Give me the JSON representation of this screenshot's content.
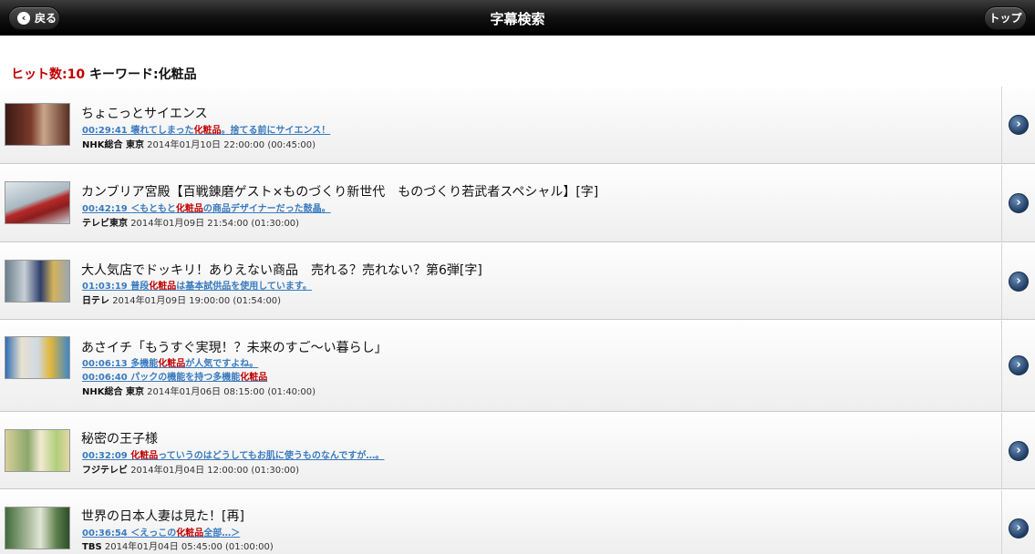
{
  "header": {
    "title": "字幕検索",
    "back_label": "戻る",
    "top_label": "トップ"
  },
  "search": {
    "hits_label": "ヒット数:10",
    "keyword_label": "キーワード:化粧品"
  },
  "colors": {
    "accent_red": "#c00000",
    "link_blue": "#3a7bbf"
  },
  "results": [
    {
      "title": "ちょこっとサイエンス",
      "subs": [
        {
          "time": "00:29:41",
          "before": "壊れてしまった",
          "kw": "化粧品",
          "after": "。捨てる前にサイエンス！"
        }
      ],
      "channel": "NHK総合 東京",
      "date": "2014年01月10日 22:00:00 (00:45:00)"
    },
    {
      "title": "カンブリア宮殿【百戦錬磨ゲスト×ものづくり新世代　ものづくり若武者スペシャル】[字]",
      "subs": [
        {
          "time": "00:42:19",
          "before": "＜もともと",
          "kw": "化粧品",
          "after": "の商品デザイナーだった鼓晶。"
        }
      ],
      "channel": "テレビ東京",
      "date": "2014年01月09日 21:54:00 (01:30:00)"
    },
    {
      "title": "大人気店でドッキリ！ありえない商品　売れる？売れない？第6弾[字]",
      "subs": [
        {
          "time": "01:03:19",
          "before": "普段",
          "kw": "化粧品",
          "after": "は基本試供品を使用しています。"
        }
      ],
      "channel": "日テレ",
      "date": "2014年01月09日 19:00:00 (01:54:00)"
    },
    {
      "title": "あさイチ「もうすぐ実現！？未来のすご～い暮らし」",
      "subs": [
        {
          "time": "00:06:13",
          "before": "多機能",
          "kw": "化粧品",
          "after": "が人気ですよね。"
        },
        {
          "time": "00:06:40",
          "before": "パックの機能を持つ多機能",
          "kw": "化粧品",
          "after": ""
        }
      ],
      "channel": "NHK総合 東京",
      "date": "2014年01月06日 08:15:00 (01:40:00)"
    },
    {
      "title": "秘密の王子様",
      "subs": [
        {
          "time": "00:32:09",
          "before": "",
          "kw": "化粧品",
          "after": "っていうのはどうしてもお肌に使うものなんですが…。"
        }
      ],
      "channel": "フジテレビ",
      "date": "2014年01月04日 12:00:00 (01:30:00)"
    },
    {
      "title": "世界の日本人妻は見た！[再]",
      "subs": [
        {
          "time": "00:36:54",
          "before": "＜えっこの",
          "kw": "化粧品",
          "after": "全部…＞"
        }
      ],
      "channel": "TBS",
      "date": "2014年01月04日 05:45:00 (01:00:00)"
    }
  ]
}
